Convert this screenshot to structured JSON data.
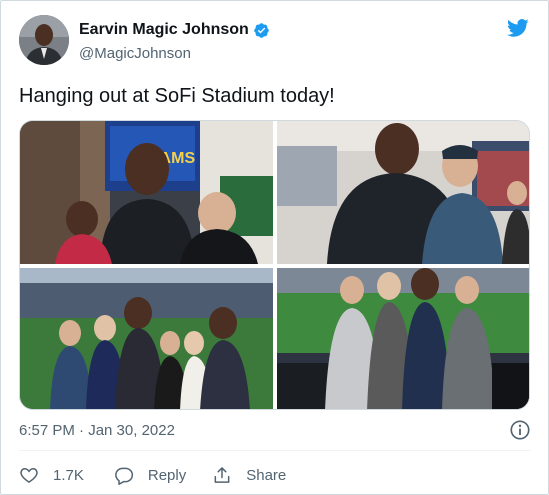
{
  "author": {
    "display_name": "Earvin Magic Johnson",
    "handle": "@MagicJohnson",
    "verified": true
  },
  "tweet": {
    "text": "Hanging out at SoFi Stadium today!",
    "timestamp": "6:57 PM · Jan 30, 2022"
  },
  "media": {
    "photos": [
      {
        "subject": "group photo with stadium screen",
        "screen_text": "RAMS"
      },
      {
        "subject": "two men in stadium suite"
      },
      {
        "subject": "group of six on stadium field"
      },
      {
        "subject": "group in stadium seats"
      }
    ]
  },
  "actions": {
    "like_count": "1.7K",
    "reply_label": "Reply",
    "share_label": "Share"
  },
  "colors": {
    "brand_blue": "#1d9bf0",
    "secondary_text": "#536471",
    "primary_text": "#0f1419",
    "border": "#cfd9de"
  },
  "icons": [
    "twitter-bird-icon",
    "verified-badge-icon",
    "info-icon",
    "heart-icon",
    "reply-bubble-icon",
    "share-icon"
  ]
}
